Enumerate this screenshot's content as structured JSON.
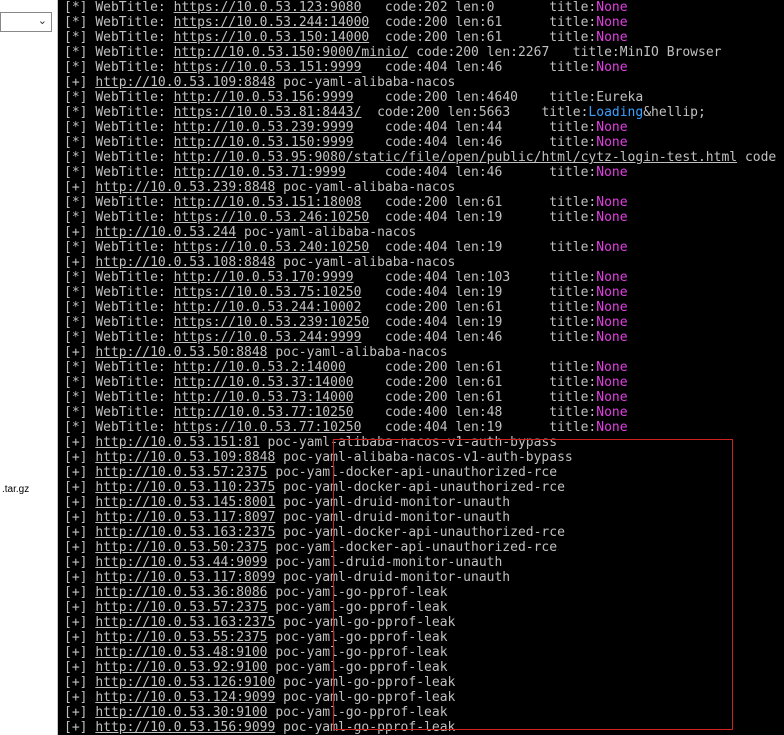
{
  "left_panel": {
    "file_label": ".tar.gz",
    "dropdown_icon": "chevron-down-icon"
  },
  "terminal": {
    "lines": [
      {
        "prefix": "[*]",
        "type": "webtitle",
        "url": "https://10.0.53.123:9080",
        "rest": "   code:202 len:0       title:",
        "title": "None"
      },
      {
        "prefix": "[*]",
        "type": "webtitle",
        "url": "https://10.0.53.244:14000",
        "rest": "  code:200 len:61      title:",
        "title": "None"
      },
      {
        "prefix": "[*]",
        "type": "webtitle",
        "url": "https://10.0.53.150:14000",
        "rest": "  code:200 len:61      title:",
        "title": "None"
      },
      {
        "prefix": "[*]",
        "type": "webtitle",
        "url": "http://10.0.53.150:9000/minio/",
        "rest": " code:200 len:2267   title:",
        "title": "MinIO Browser"
      },
      {
        "prefix": "[*]",
        "type": "webtitle",
        "url": "https://10.0.53.151:9999",
        "rest": "   code:404 len:46      title:",
        "title": "None"
      },
      {
        "prefix": "[+]",
        "type": "poc",
        "url": "http://10.0.53.109:8848",
        "poc": "poc-yaml-alibaba-nacos"
      },
      {
        "prefix": "[*]",
        "type": "webtitle",
        "url": "http://10.0.53.156:9999",
        "rest": "    code:200 len:4640    title:",
        "title": "Eureka"
      },
      {
        "prefix": "[*]",
        "type": "webtitle",
        "url": "https://10.0.53.81:8443/",
        "rest": "  code:200 len:5663    title:",
        "title": "Loading",
        "title_suffix": "&hellip;"
      },
      {
        "prefix": "[*]",
        "type": "webtitle",
        "url": "http://10.0.53.239:9999",
        "rest": "    code:404 len:44      title:",
        "title": "None"
      },
      {
        "prefix": "[*]",
        "type": "webtitle",
        "url": "http://10.0.53.150:9999",
        "rest": "    code:404 len:46      title:",
        "title": "None"
      },
      {
        "prefix": "[*]",
        "type": "webtitle",
        "url": "http://10.0.53.95:9080/static/file/open/public/html/cytz-login-test.html",
        "rest": " code",
        "title": ""
      },
      {
        "prefix": "[*]",
        "type": "webtitle",
        "url": "http://10.0.53.71:9999",
        "rest": "     code:404 len:46      title:",
        "title": "None"
      },
      {
        "prefix": "[+]",
        "type": "poc",
        "url": "http://10.0.53.239:8848",
        "poc": "poc-yaml-alibaba-nacos"
      },
      {
        "prefix": "[*]",
        "type": "webtitle",
        "url": "http://10.0.53.151:18008",
        "rest": "   code:200 len:61      title:",
        "title": "None"
      },
      {
        "prefix": "[*]",
        "type": "webtitle",
        "url": "https://10.0.53.246:10250",
        "rest": "  code:404 len:19      title:",
        "title": "None"
      },
      {
        "prefix": "[+]",
        "type": "poc",
        "url": "http://10.0.53.244",
        "poc": "poc-yaml-alibaba-nacos"
      },
      {
        "prefix": "[*]",
        "type": "webtitle",
        "url": "https://10.0.53.240:10250",
        "rest": "  code:404 len:19      title:",
        "title": "None"
      },
      {
        "prefix": "[+]",
        "type": "poc",
        "url": "http://10.0.53.108:8848",
        "poc": "poc-yaml-alibaba-nacos"
      },
      {
        "prefix": "[*]",
        "type": "webtitle",
        "url": "http://10.0.53.170:9999",
        "rest": "    code:404 len:103     title:",
        "title": "None"
      },
      {
        "prefix": "[*]",
        "type": "webtitle",
        "url": "https://10.0.53.75:10250",
        "rest": "   code:404 len:19      title:",
        "title": "None"
      },
      {
        "prefix": "[*]",
        "type": "webtitle",
        "url": "http://10.0.53.244:10002",
        "rest": "   code:200 len:61      title:",
        "title": "None"
      },
      {
        "prefix": "[*]",
        "type": "webtitle",
        "url": "https://10.0.53.239:10250",
        "rest": "  code:404 len:19      title:",
        "title": "None"
      },
      {
        "prefix": "[*]",
        "type": "webtitle",
        "url": "https://10.0.53.244:9999",
        "rest": "   code:404 len:46      title:",
        "title": "None"
      },
      {
        "prefix": "[+]",
        "type": "poc",
        "url": "http://10.0.53.50:8848",
        "poc": "poc-yaml-alibaba-nacos"
      },
      {
        "prefix": "[*]",
        "type": "webtitle",
        "url": "http://10.0.53.2:14000",
        "rest": "     code:200 len:61      title:",
        "title": "None"
      },
      {
        "prefix": "[*]",
        "type": "webtitle",
        "url": "http://10.0.53.37:14000",
        "rest": "    code:200 len:61      title:",
        "title": "None"
      },
      {
        "prefix": "[*]",
        "type": "webtitle",
        "url": "http://10.0.53.73:14000",
        "rest": "    code:200 len:61      title:",
        "title": "None"
      },
      {
        "prefix": "[*]",
        "type": "webtitle",
        "url": "http://10.0.53.77:10250",
        "rest": "    code:400 len:48      title:",
        "title": "None"
      },
      {
        "prefix": "[*]",
        "type": "webtitle",
        "url": "https://10.0.53.77:10250",
        "rest": "   code:404 len:19      title:",
        "title": "None"
      },
      {
        "prefix": "[+]",
        "type": "poc",
        "url": "http://10.0.53.151:81",
        "poc": "poc-yaml-alibaba-nacos-v1-auth-bypass"
      },
      {
        "prefix": "[+]",
        "type": "poc",
        "url": "http://10.0.53.109:8848",
        "poc": "poc-yaml-alibaba-nacos-v1-auth-bypass"
      },
      {
        "prefix": "[+]",
        "type": "poc",
        "url": "http://10.0.53.57:2375",
        "poc": "poc-yaml-docker-api-unauthorized-rce"
      },
      {
        "prefix": "[+]",
        "type": "poc",
        "url": "http://10.0.53.110:2375",
        "poc": "poc-yaml-docker-api-unauthorized-rce"
      },
      {
        "prefix": "[+]",
        "type": "poc",
        "url": "http://10.0.53.145:8001",
        "poc": "poc-yaml-druid-monitor-unauth"
      },
      {
        "prefix": "[+]",
        "type": "poc",
        "url": "http://10.0.53.117:8097",
        "poc": "poc-yaml-druid-monitor-unauth"
      },
      {
        "prefix": "[+]",
        "type": "poc",
        "url": "http://10.0.53.163:2375",
        "poc": "poc-yaml-docker-api-unauthorized-rce"
      },
      {
        "prefix": "[+]",
        "type": "poc",
        "url": "http://10.0.53.50:2375",
        "poc": "poc-yaml-docker-api-unauthorized-rce"
      },
      {
        "prefix": "[+]",
        "type": "poc",
        "url": "http://10.0.53.44:9099",
        "poc": "poc-yaml-druid-monitor-unauth"
      },
      {
        "prefix": "[+]",
        "type": "poc",
        "url": "http://10.0.53.117:8099",
        "poc": "poc-yaml-druid-monitor-unauth"
      },
      {
        "prefix": "[+]",
        "type": "poc",
        "url": "http://10.0.53.36:8086",
        "poc": "poc-yaml-go-pprof-leak"
      },
      {
        "prefix": "[+]",
        "type": "poc",
        "url": "http://10.0.53.57:2375",
        "poc": "poc-yaml-go-pprof-leak"
      },
      {
        "prefix": "[+]",
        "type": "poc",
        "url": "http://10.0.53.163:2375",
        "poc": "poc-yaml-go-pprof-leak"
      },
      {
        "prefix": "[+]",
        "type": "poc",
        "url": "http://10.0.53.55:2375",
        "poc": "poc-yaml-go-pprof-leak"
      },
      {
        "prefix": "[+]",
        "type": "poc",
        "url": "http://10.0.53.48:9100",
        "poc": "poc-yaml-go-pprof-leak"
      },
      {
        "prefix": "[+]",
        "type": "poc",
        "url": "http://10.0.53.92:9100",
        "poc": "poc-yaml-go-pprof-leak"
      },
      {
        "prefix": "[+]",
        "type": "poc",
        "url": "http://10.0.53.126:9100",
        "poc": "poc-yaml-go-pprof-leak"
      },
      {
        "prefix": "[+]",
        "type": "poc",
        "url": "http://10.0.53.124:9099",
        "poc": "poc-yaml-go-pprof-leak"
      },
      {
        "prefix": "[+]",
        "type": "poc",
        "url": "http://10.0.53.30:9100",
        "poc": "poc-yaml-go-pprof-leak"
      },
      {
        "prefix": "[+]",
        "type": "poc",
        "url": "http://10.0.53.156:9099",
        "poc": "poc-yaml-go-pprof-leak"
      }
    ]
  },
  "colors": {
    "terminal_bg": "#000000",
    "text": "#c0c0c0",
    "none_title": "#e040e0",
    "loading_title": "#3aa0ff",
    "highlight_border": "#d02020"
  }
}
